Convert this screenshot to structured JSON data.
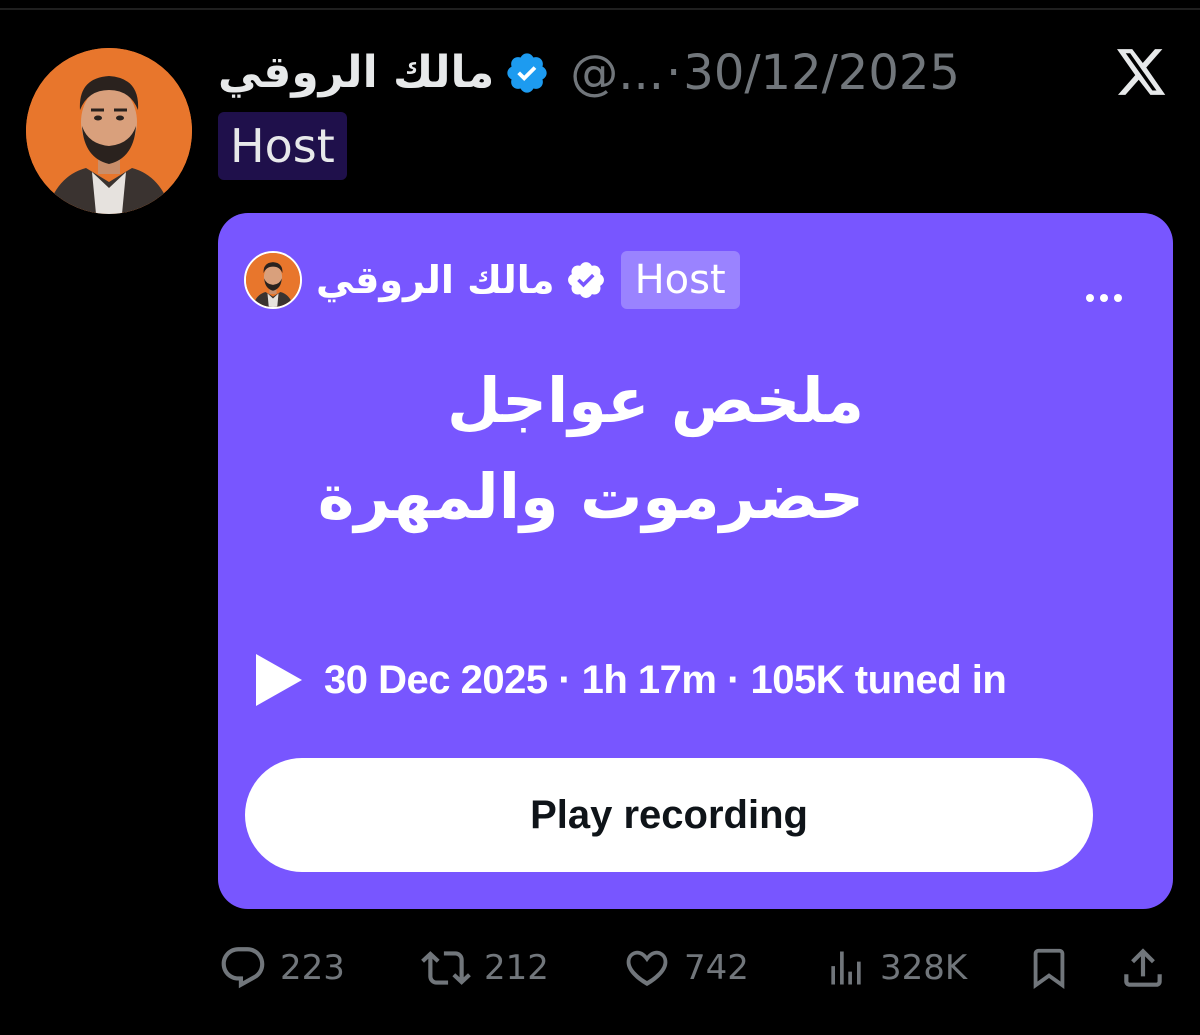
{
  "tweet": {
    "author_name": "مالك الروقي",
    "handle": "@...",
    "separator": "·",
    "date": "30/12/2025",
    "tag": "Host"
  },
  "space": {
    "host_name": "مالك الروقي",
    "host_tag": "Host",
    "title": "ملخص عواجل حضرموت والمهرة",
    "meta": "30 Dec 2025 · 1h 17m · 105K tuned in",
    "play_label": "Play recording"
  },
  "actions": {
    "replies": "223",
    "reposts": "212",
    "likes": "742",
    "views": "328K"
  },
  "icons": {
    "verified": "verified-badge-icon",
    "x_logo": "x-logo-icon",
    "more": "more-icon",
    "play": "play-icon",
    "reply": "reply-icon",
    "repost": "repost-icon",
    "like": "heart-icon",
    "views": "views-icon",
    "bookmark": "bookmark-icon",
    "share": "share-icon"
  },
  "colors": {
    "background": "#000000",
    "card": "#7856ff",
    "tag_bg": "#1f104b",
    "card_tag_bg": "#9a83ff",
    "verified": "#1d9bf0",
    "muted_text": "#71767b",
    "avatar_bg": "#e8762c"
  }
}
